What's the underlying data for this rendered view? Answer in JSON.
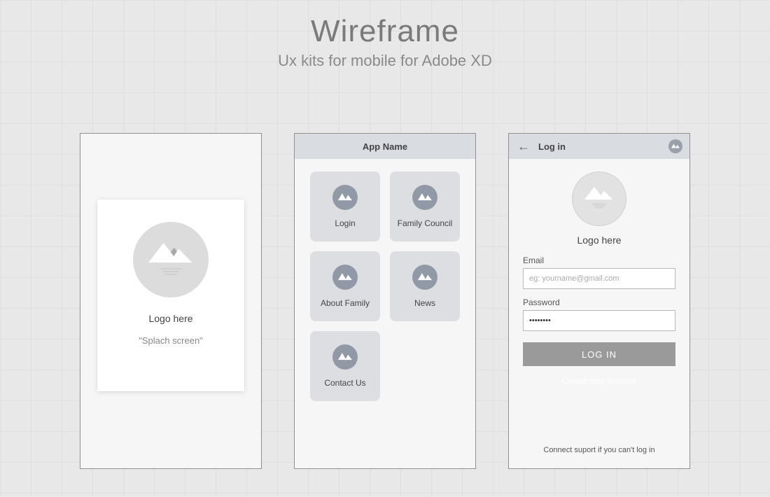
{
  "header": {
    "title": "Wireframe",
    "subtitle": "Ux kits for mobile for Adobe XD"
  },
  "screen1": {
    "logo_label": "Logo here",
    "sublabel": "\"Splach screen\""
  },
  "screen2": {
    "appbar_title": "App Name",
    "tiles": [
      {
        "label": "Login"
      },
      {
        "label": "Family Council"
      },
      {
        "label": "About Family"
      },
      {
        "label": "News"
      },
      {
        "label": "Contact Us"
      }
    ]
  },
  "screen3": {
    "appbar_title": "Log in",
    "logo_label": "Logo here",
    "email_label": "Email",
    "email_placeholder": "eg: yourname@gmail.com",
    "password_label": "Password",
    "password_value": "••••••••",
    "login_button": "LOG IN",
    "create_link": "Create new account",
    "support_text": "Connect suport if you can't log in"
  }
}
